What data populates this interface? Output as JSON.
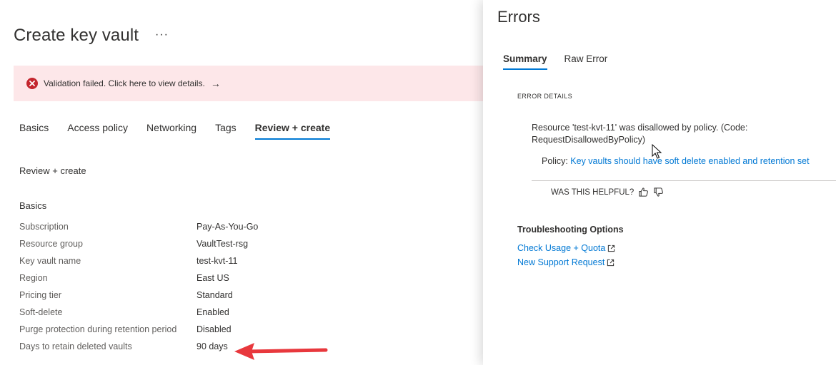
{
  "blade": {
    "title": "Create key vault",
    "more_label": "···",
    "banner": {
      "message": "Validation failed. Click here to view details.",
      "arrow": "→",
      "color": "#fde7e9",
      "icon": "error-circle-icon"
    },
    "tabs": [
      {
        "label": "Basics",
        "active": false
      },
      {
        "label": "Access policy",
        "active": false
      },
      {
        "label": "Networking",
        "active": false
      },
      {
        "label": "Tags",
        "active": false
      },
      {
        "label": "Review + create",
        "active": true
      }
    ],
    "section_title": "Review + create",
    "basics_title": "Basics",
    "basics": [
      {
        "key": "Subscription",
        "value": "Pay-As-You-Go"
      },
      {
        "key": "Resource group",
        "value": "VaultTest-rsg"
      },
      {
        "key": "Key vault name",
        "value": "test-kvt-11"
      },
      {
        "key": "Region",
        "value": "East US"
      },
      {
        "key": "Pricing tier",
        "value": "Standard"
      },
      {
        "key": "Soft-delete",
        "value": "Enabled"
      },
      {
        "key": "Purge protection during retention period",
        "value": "Disabled"
      },
      {
        "key": "Days to retain deleted vaults",
        "value": "90 days"
      }
    ]
  },
  "errors_panel": {
    "title": "Errors",
    "tabs": [
      {
        "label": "Summary",
        "active": true
      },
      {
        "label": "Raw Error",
        "active": false
      }
    ],
    "details_label": "ERROR DETAILS",
    "message": "Resource 'test-kvt-11' was disallowed by policy. (Code: RequestDisallowedByPolicy)",
    "policy_prefix": "Policy: ",
    "policy_link": "Key vaults should have soft delete enabled and retention set",
    "helpful_label": "WAS THIS HELPFUL?",
    "troubleshooting_title": "Troubleshooting Options",
    "links": [
      {
        "label": "Check Usage + Quota",
        "icon": "external-link-icon"
      },
      {
        "label": "New Support Request",
        "icon": "external-link-icon"
      }
    ]
  },
  "colors": {
    "accent": "#0078d4",
    "error": "#c4262e",
    "annotation_arrow": "#e8383d"
  }
}
